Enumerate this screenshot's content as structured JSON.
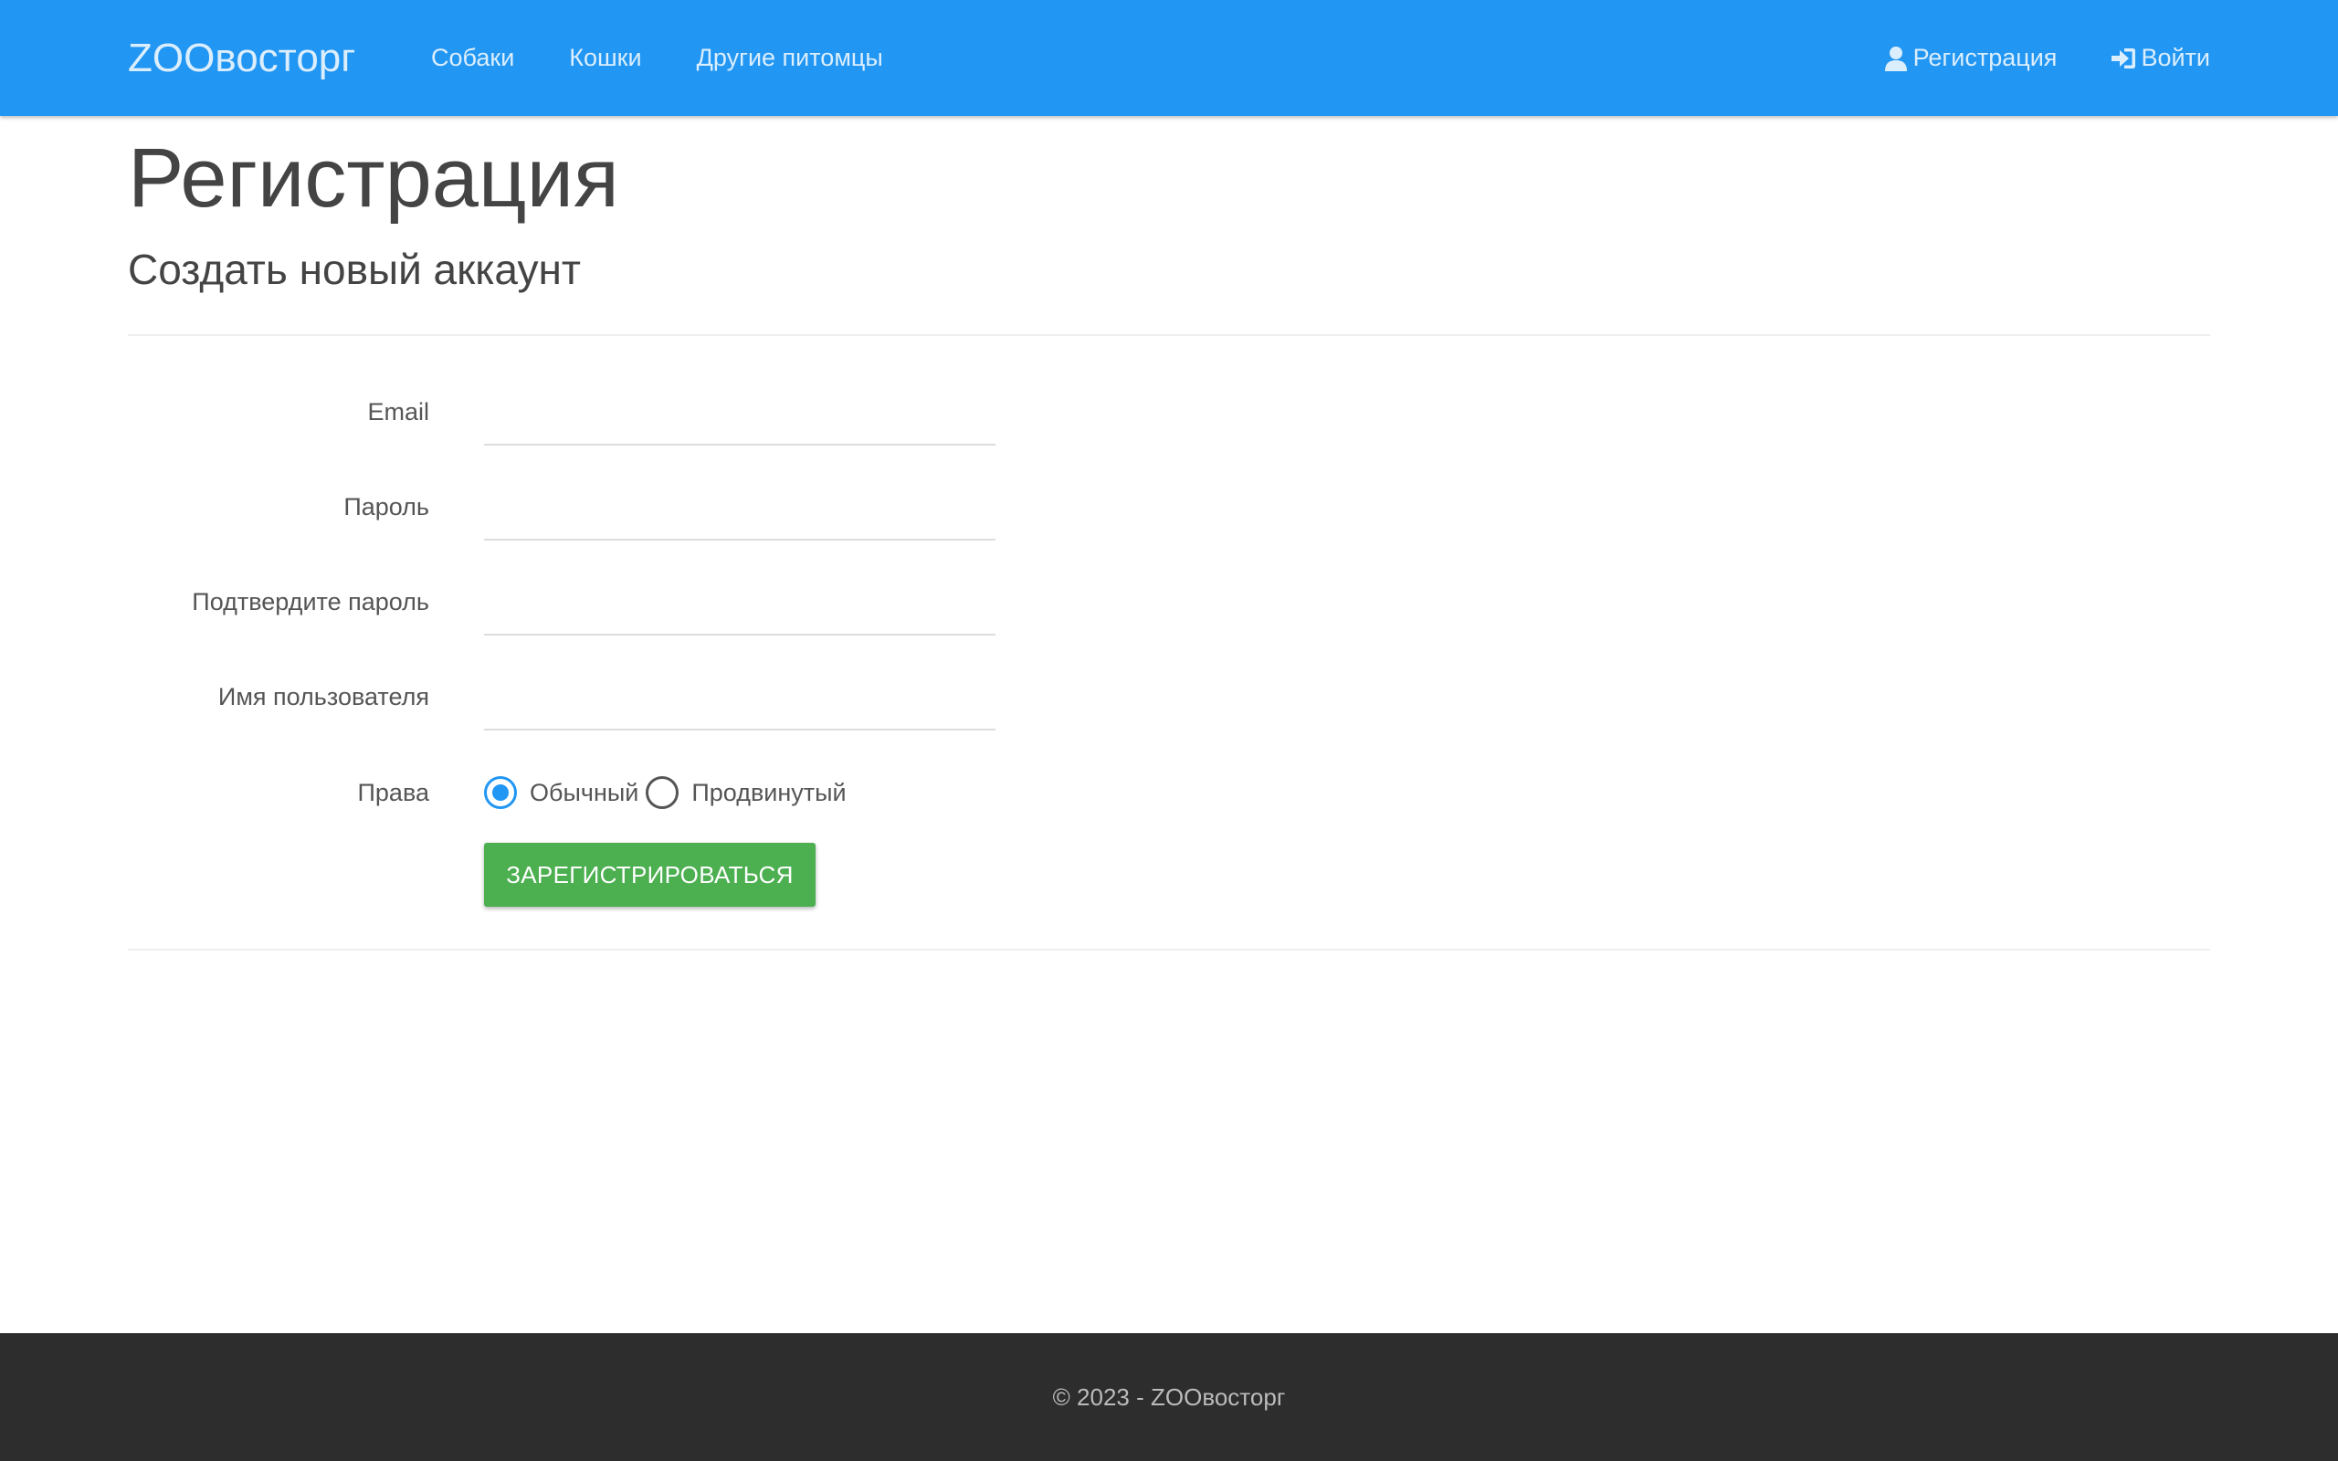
{
  "navbar": {
    "brand": "ZOOвосторг",
    "links": [
      {
        "label": "Собаки"
      },
      {
        "label": "Кошки"
      },
      {
        "label": "Другие питомцы"
      }
    ],
    "register_label": "Регистрация",
    "register_icon": "user-icon",
    "login_label": "Войти",
    "login_icon": "log-in-icon"
  },
  "page": {
    "title": "Регистрация",
    "subtitle": "Создать новый аккаунт"
  },
  "form": {
    "email": {
      "label": "Email",
      "value": ""
    },
    "password": {
      "label": "Пароль",
      "value": ""
    },
    "confirm_password": {
      "label": "Подтвердите пароль",
      "value": ""
    },
    "username": {
      "label": "Имя пользователя",
      "value": ""
    },
    "rights": {
      "label": "Права",
      "options": [
        {
          "label": "Обычный",
          "checked": true
        },
        {
          "label": "Продвинутый",
          "checked": false
        }
      ]
    },
    "submit_label": "ЗАРЕГИСТРИРОВАТЬСЯ"
  },
  "footer": {
    "text": "© 2023 - ZOOвосторг"
  },
  "colors": {
    "navbar": "#2196f3",
    "submit": "#4caf50",
    "footer": "#2d2d2d",
    "radio_checked": "#2196f3"
  }
}
